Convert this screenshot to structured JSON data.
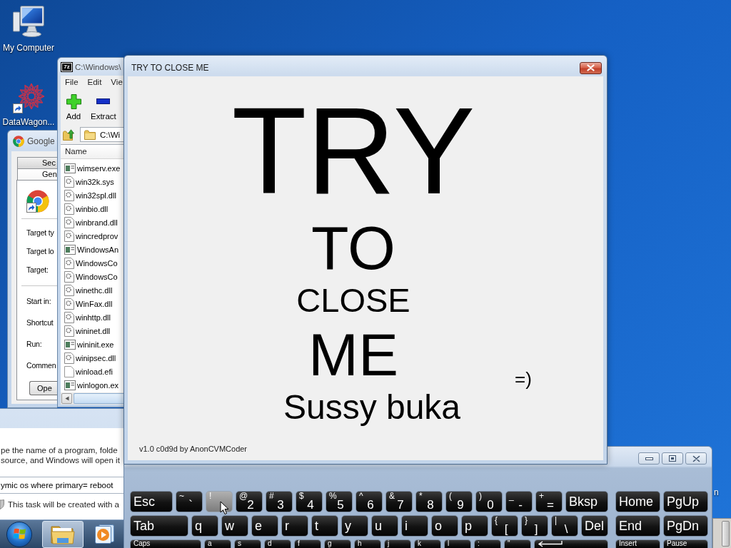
{
  "desktop_icons": [
    {
      "label": "My Computer",
      "kind": "computer"
    },
    {
      "label": "DataWagon...",
      "kind": "mesh"
    }
  ],
  "archive_window": {
    "icon_text": "7z",
    "title": "C:\\Windows\\",
    "menu": [
      "File",
      "Edit",
      "Vie"
    ],
    "toolbar": [
      {
        "label": "Add",
        "kind": "add"
      },
      {
        "label": "Extract",
        "kind": "extract"
      }
    ],
    "path": "C:\\Wi",
    "columns": [
      "Name"
    ],
    "files": [
      {
        "name": "wimserv.exe",
        "kind": "program"
      },
      {
        "name": "win32k.sys",
        "kind": "library"
      },
      {
        "name": "win32spl.dll",
        "kind": "library"
      },
      {
        "name": "winbio.dll",
        "kind": "library"
      },
      {
        "name": "winbrand.dll",
        "kind": "library"
      },
      {
        "name": "wincredprov",
        "kind": "library"
      },
      {
        "name": "WindowsAn",
        "kind": "program"
      },
      {
        "name": "WindowsCo",
        "kind": "library"
      },
      {
        "name": "WindowsCo",
        "kind": "library"
      },
      {
        "name": "winethc.dll",
        "kind": "library"
      },
      {
        "name": "WinFax.dll",
        "kind": "library"
      },
      {
        "name": "winhttp.dll",
        "kind": "library"
      },
      {
        "name": "wininet.dll",
        "kind": "library"
      },
      {
        "name": "wininit.exe",
        "kind": "program"
      },
      {
        "name": "winipsec.dll",
        "kind": "library"
      },
      {
        "name": "winload.efi",
        "kind": "plain"
      },
      {
        "name": "winlogon.ex",
        "kind": "program"
      }
    ]
  },
  "main_window": {
    "title": "TRY TO CLOSE ME",
    "message": [
      "TRY",
      "TO",
      "CLOSE",
      "ME"
    ],
    "emoticon": "=)",
    "subtitle": "Sussy buka",
    "credit": "v1.0 c0d9d by AnonCVMCoder"
  },
  "properties_window": {
    "title": "Google",
    "tabs": [
      {
        "label": "Sec",
        "selected": false
      },
      {
        "label": "Gen",
        "selected": true
      }
    ],
    "field_groups": [
      [
        "Target ty",
        "Target lo",
        "Target:"
      ],
      [
        "Start in:",
        "Shortcut",
        "Run:",
        "Commen"
      ]
    ],
    "button": "Ope"
  },
  "run_dialog": {
    "description": [
      "pe the name of a program, folde",
      "source, and Windows will open it"
    ],
    "command": {
      "value": "ymic os where primary= reboot"
    },
    "note": "This task will be created with a"
  },
  "keyboard": {
    "rows": [
      {
        "keys": [
          {
            "kind": "wide",
            "label": "Esc",
            "highlighted": false
          },
          {
            "kind": "dual",
            "shift": "~",
            "label": "`",
            "highlighted": false
          },
          {
            "kind": "dual",
            "shift": "!",
            "highlighted": true
          },
          {
            "kind": "dual",
            "shift": "@",
            "label": "2",
            "highlighted": false
          },
          {
            "kind": "dual",
            "shift": "#",
            "label": "3",
            "highlighted": false
          },
          {
            "kind": "dual",
            "shift": "$",
            "label": "4",
            "highlighted": false
          },
          {
            "kind": "dual",
            "shift": "%",
            "label": "5",
            "highlighted": false
          },
          {
            "kind": "dual",
            "shift": "^",
            "label": "6",
            "highlighted": false
          },
          {
            "kind": "dual",
            "shift": "&",
            "label": "7",
            "highlighted": false
          },
          {
            "kind": "dual",
            "shift": "*",
            "label": "8",
            "highlighted": false
          },
          {
            "kind": "dual",
            "shift": "(",
            "label": "9",
            "highlighted": false
          },
          {
            "kind": "dual",
            "shift": ")",
            "label": "0",
            "highlighted": false
          },
          {
            "kind": "dual",
            "shift": "_",
            "label": "-",
            "highlighted": false
          },
          {
            "kind": "dual",
            "shift": "+",
            "label": "=",
            "highlighted": false
          },
          {
            "kind": "wide",
            "label": "Bksp",
            "highlighted": false
          }
        ],
        "nav_keys": [
          {
            "kind": "wide",
            "label": "Home",
            "highlighted": false
          },
          {
            "kind": "wide",
            "label": "PgUp",
            "highlighted": false
          }
        ]
      },
      {
        "keys": [
          {
            "kind": "wide",
            "label": "Tab",
            "highlighted": false
          },
          {
            "kind": "standard",
            "label": "q",
            "highlighted": false
          },
          {
            "kind": "standard",
            "label": "w",
            "highlighted": false
          },
          {
            "kind": "standard",
            "label": "e",
            "highlighted": false
          },
          {
            "kind": "standard",
            "label": "r",
            "highlighted": false
          },
          {
            "kind": "standard",
            "label": "t",
            "highlighted": false
          },
          {
            "kind": "standard",
            "label": "y",
            "highlighted": false
          },
          {
            "kind": "standard",
            "label": "u",
            "highlighted": false
          },
          {
            "kind": "standard",
            "label": "i",
            "highlighted": false
          },
          {
            "kind": "standard",
            "label": "o",
            "highlighted": false
          },
          {
            "kind": "standard",
            "label": "p",
            "highlighted": false
          },
          {
            "kind": "dual",
            "shift": "{",
            "label": "[",
            "highlighted": false
          },
          {
            "kind": "dual",
            "shift": "}",
            "label": "]",
            "highlighted": false
          },
          {
            "kind": "dual",
            "shift": "|",
            "label": "\\",
            "highlighted": false
          },
          {
            "kind": "standard",
            "label": "Del",
            "highlighted": false
          }
        ],
        "nav_keys": [
          {
            "kind": "wide",
            "label": "End",
            "highlighted": false
          },
          {
            "kind": "wide",
            "label": "PgDn",
            "highlighted": false
          }
        ]
      },
      {
        "keys": [
          {
            "kind": "wide",
            "label": "Caps",
            "highlighted": false
          },
          {
            "kind": "standard",
            "label": "a",
            "highlighted": false
          },
          {
            "kind": "standard",
            "label": "s",
            "highlighted": false
          },
          {
            "kind": "standard",
            "label": "d",
            "highlighted": false
          },
          {
            "kind": "standard",
            "label": "f",
            "highlighted": false
          },
          {
            "kind": "standard",
            "label": "g",
            "highlighted": false
          },
          {
            "kind": "standard",
            "label": "h",
            "highlighted": false
          },
          {
            "kind": "standard",
            "label": "j",
            "highlighted": false
          },
          {
            "kind": "standard",
            "label": "k",
            "highlighted": false
          },
          {
            "kind": "standard",
            "label": "l",
            "highlighted": false
          },
          {
            "kind": "dual",
            "shift": ":",
            "highlighted": false
          },
          {
            "kind": "dual",
            "shift": "\"",
            "highlighted": false
          },
          {
            "kind": "enter",
            "highlighted": false
          }
        ],
        "nav_keys": [
          {
            "kind": "wide",
            "label": "Insert",
            "highlighted": false
          },
          {
            "kind": "wide",
            "label": "Pause",
            "highlighted": false
          }
        ]
      }
    ]
  },
  "taskbar": {
    "buttons": [
      {
        "kind": "start",
        "selected": false
      },
      {
        "kind": "explorer",
        "selected": true
      },
      {
        "kind": "media",
        "selected": false
      }
    ]
  },
  "desktop_label_fragment": "n"
}
